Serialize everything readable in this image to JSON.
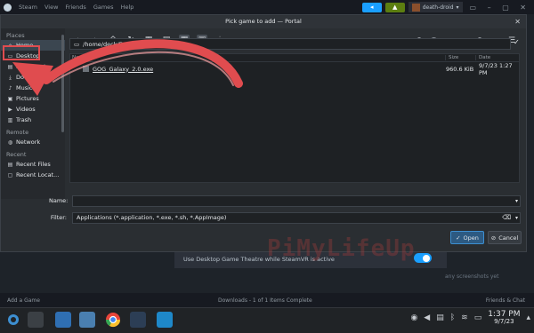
{
  "steam": {
    "menu": [
      "Steam",
      "View",
      "Friends",
      "Games",
      "Help"
    ],
    "username": "death-droid",
    "option_text": "Use Desktop Game Theatre while SteamVR is active",
    "screenshots_text": "any screenshots yet",
    "add_game": "Add a Game",
    "downloads": "Downloads - 1 of 1 Items Complete",
    "friends_chat": "Friends & Chat"
  },
  "dialog": {
    "title": "Pick game to add — Portal",
    "places_title": "Places",
    "places": [
      {
        "label": "Home",
        "icon": "home-icon"
      },
      {
        "label": "Desktop",
        "icon": "desktop-icon"
      },
      {
        "label": "Documents",
        "icon": "documents-icon"
      },
      {
        "label": "Downloads",
        "icon": "downloads-icon"
      },
      {
        "label": "Music",
        "icon": "music-icon"
      },
      {
        "label": "Pictures",
        "icon": "pictures-icon"
      },
      {
        "label": "Videos",
        "icon": "videos-icon"
      },
      {
        "label": "Trash",
        "icon": "trash-icon"
      }
    ],
    "remote_title": "Remote",
    "remote": [
      {
        "label": "Network",
        "icon": "network-icon"
      }
    ],
    "recent_title": "Recent",
    "recent": [
      {
        "label": "Recent Files",
        "icon": "recent-files-icon"
      },
      {
        "label": "Recent Locat...",
        "icon": "recent-locations-icon"
      }
    ],
    "path": "/home/deck/Downloads/",
    "columns": {
      "name": "Name",
      "size": "Size",
      "date": "Date"
    },
    "files": [
      {
        "name": "GOG_Galaxy_2.0.exe",
        "size": "960.6 KiB",
        "date": "9/7/23 1:27 PM"
      }
    ],
    "name_label": "Name:",
    "name_value": "",
    "filter_label": "Filter:",
    "filter_value": "Applications (*.application, *.exe, *.sh, *.AppImage)",
    "open_label": "Open",
    "cancel_label": "Cancel"
  },
  "watermark": "PiMyLifeUp",
  "taskbar": {
    "time": "1:37 PM",
    "date": "9/7/23"
  },
  "colors": {
    "accent": "#1a9fff",
    "annotation": "#e04c4f"
  }
}
